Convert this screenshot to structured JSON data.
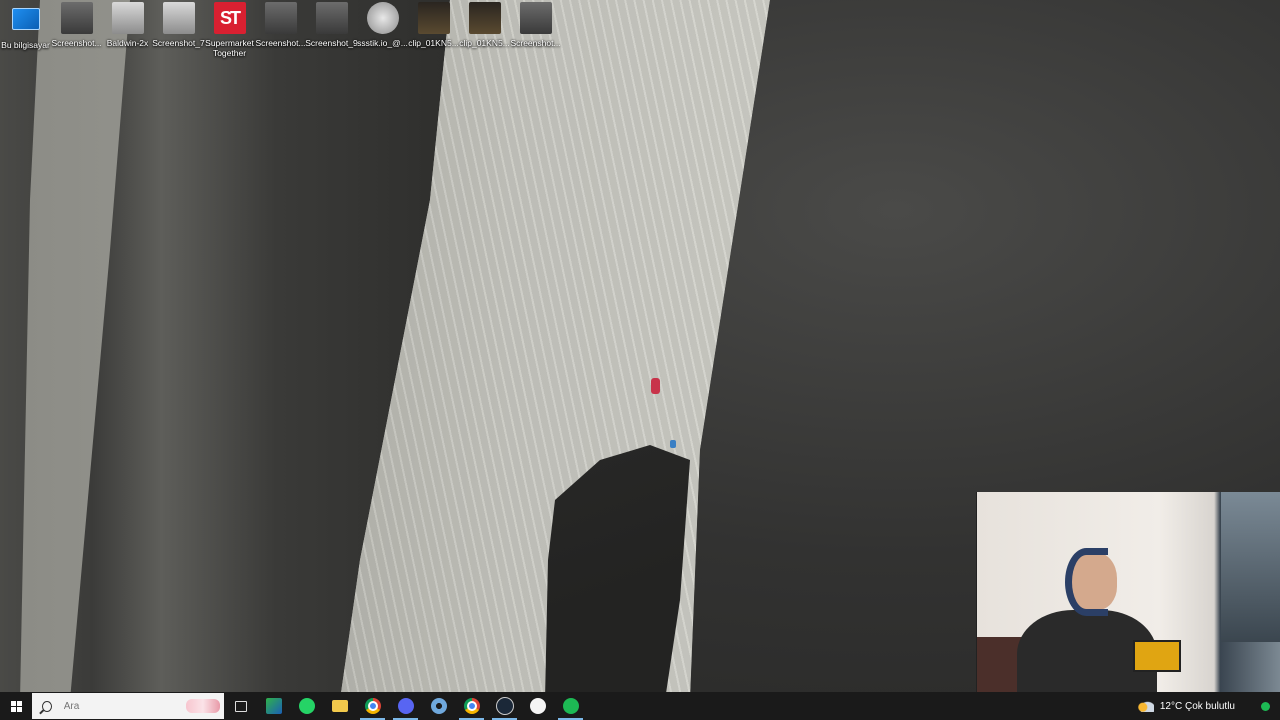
{
  "desktop": {
    "icons": [
      {
        "label": "Bu bilgisayar",
        "icon": "computer-icon"
      },
      {
        "label": "Screenshot...",
        "icon": "image-file-icon"
      },
      {
        "label": "Baldwin-2x",
        "icon": "image-file-icon"
      },
      {
        "label": "Screenshot_7",
        "icon": "image-file-icon"
      },
      {
        "label": "Supermarket Together",
        "icon": "game-shortcut-icon"
      },
      {
        "label": "Screenshot...",
        "icon": "image-file-icon"
      },
      {
        "label": "Screenshot_9",
        "icon": "image-file-icon"
      },
      {
        "label": "ssstik.io_@...",
        "icon": "image-file-icon"
      },
      {
        "label": "clip_01KN5...",
        "icon": "video-file-icon"
      },
      {
        "label": "clip_01KN5...",
        "icon": "video-file-icon"
      },
      {
        "label": "Screenshot...",
        "icon": "image-file-icon"
      }
    ]
  },
  "taskbar": {
    "search_placeholder": "Ara",
    "pinned": [
      {
        "name": "task-view",
        "icon": "task-view-icon"
      },
      {
        "name": "bluestacks",
        "icon": "bluestacks-icon"
      },
      {
        "name": "whatsapp",
        "icon": "whatsapp-icon"
      },
      {
        "name": "file-explorer",
        "icon": "folder-icon"
      },
      {
        "name": "chrome",
        "icon": "chrome-icon"
      },
      {
        "name": "discord",
        "icon": "discord-icon"
      },
      {
        "name": "settings-app",
        "icon": "gear-icon"
      },
      {
        "name": "chrome-profile",
        "icon": "chrome-icon"
      },
      {
        "name": "steam",
        "icon": "steam-icon"
      },
      {
        "name": "media-player",
        "icon": "play-icon"
      },
      {
        "name": "spotify",
        "icon": "spotify-icon"
      }
    ],
    "weather": {
      "temperature": "12°C",
      "condition": "Çok bulutlu"
    }
  },
  "colors": {
    "taskbar": "#1a1a1a",
    "active_indicator": "#7cb8e8",
    "spotify": "#1db954"
  }
}
